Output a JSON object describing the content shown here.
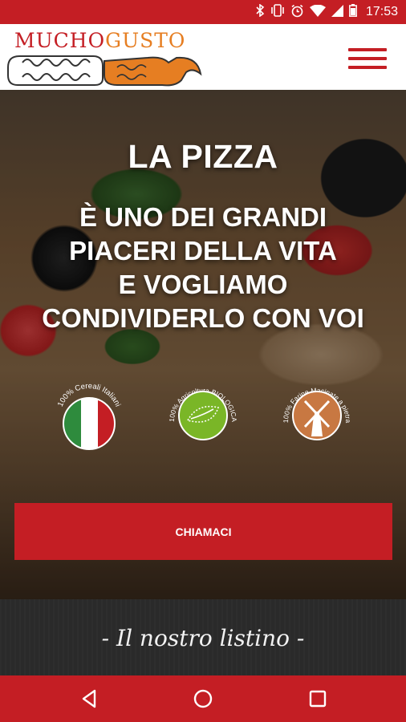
{
  "status_bar": {
    "time": "17:53",
    "icons": [
      "bluetooth-icon",
      "vibrate-icon",
      "alarm-icon",
      "wifi-icon",
      "signal-icon",
      "battery-icon"
    ]
  },
  "header": {
    "logo": {
      "word1": "MUCHO",
      "word2": "GUSTO"
    },
    "menu_icon": "hamburger-menu-icon"
  },
  "hero": {
    "title": "LA PIZZA",
    "subtitle_lines": [
      "È UNO DEI GRANDI",
      "PIACERI DELLA VITA",
      "E VOGLIAMO",
      "CONDIVIDERLO CON VOI"
    ],
    "badges": [
      {
        "text": "100% Cereali Italiani",
        "icon": "italian-flag-icon"
      },
      {
        "text": "100% Agricoltura BIOLOGICA",
        "icon": "eu-organic-leaf-icon"
      },
      {
        "text": "100% Farine Macinate a pietra",
        "icon": "windmill-icon"
      }
    ],
    "cta_label": "CHIAMACI"
  },
  "listino": {
    "title": "- Il nostro listino -"
  },
  "nav_bar": {
    "buttons": [
      "back-icon",
      "home-icon",
      "recents-icon"
    ]
  },
  "colors": {
    "brand_red": "#c41e24",
    "logo_orange": "#e67e22",
    "organic_green": "#7ab627",
    "windmill_orange": "#c87842"
  }
}
